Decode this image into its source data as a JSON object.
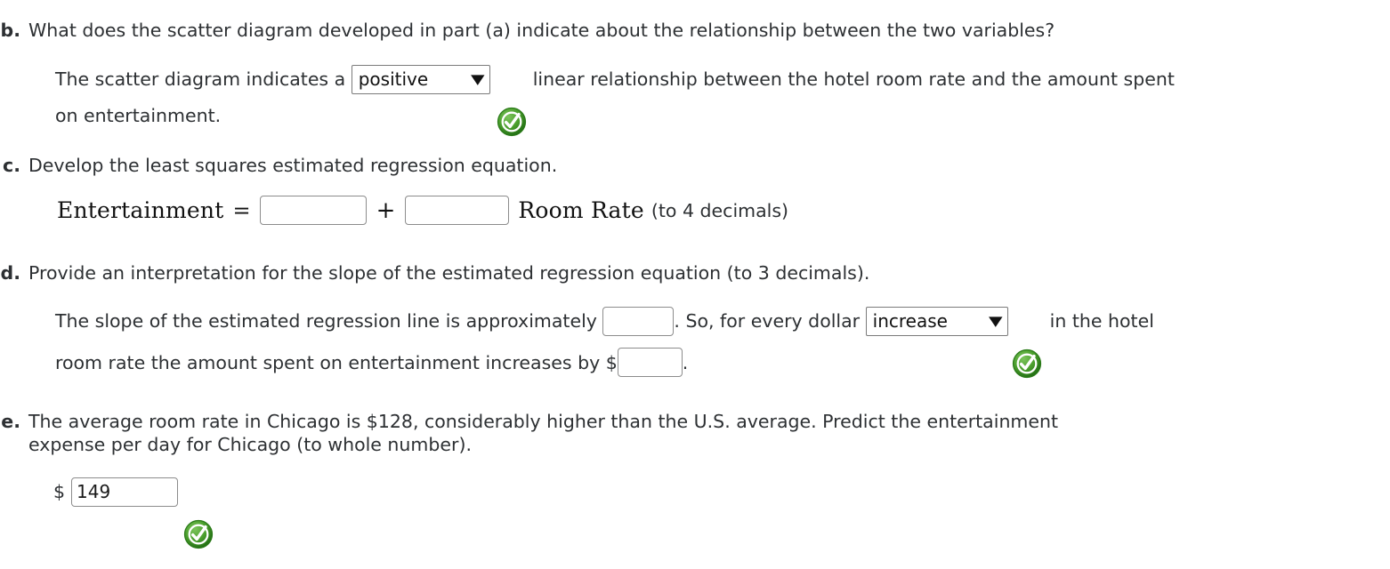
{
  "colors": {
    "text": "#2d3033",
    "check_outer": "#2d7d1f",
    "check_inner": "#4aa832",
    "check_mark": "#ffffff",
    "input_border": "#8c8c8c",
    "select_border": "#7a7a7a",
    "background": "#ffffff"
  },
  "questions": [
    {
      "label": "b.",
      "prompt": "What does the scatter diagram developed in part (a) indicate about the relationship between the two variables?",
      "answer_line_1_before": "The scatter diagram indicates a ",
      "select_value": "positive",
      "answer_line_1_after": "linear relationship between the hotel room rate and the amount spent",
      "answer_line_2": "on entertainment."
    },
    {
      "label": "c.",
      "prompt": "Develop the least squares estimated regression equation.",
      "equation_lhs": "Entertainment",
      "equation_equals": "=",
      "intercept_value": "",
      "equation_plus": "+",
      "slope_value": "",
      "equation_rhs": "Room Rate",
      "equation_hint": "(to 4 decimals)"
    },
    {
      "label": "d.",
      "prompt": "Provide an interpretation for the slope of the estimated regression equation (to 3 decimals).",
      "line1_before": "The slope of the estimated regression line is approximately ",
      "slope_value": "",
      "line1_mid": ". So, for every dollar ",
      "select_value": "increase",
      "line1_after": "in the hotel",
      "line2_before": "room rate the amount spent on entertainment increases by ",
      "line2_dollar": "$",
      "amount_value": "",
      "line2_after": "."
    },
    {
      "label": "e.",
      "prompt_line1": "The average room rate in Chicago is $128, considerably higher than the U.S. average. Predict the entertainment",
      "prompt_line2": "expense per day for Chicago (to whole number).",
      "dollar_sign": "$",
      "answer_value": "149"
    }
  ],
  "icons": {
    "check": "check-circle-icon",
    "caret": "▼"
  }
}
